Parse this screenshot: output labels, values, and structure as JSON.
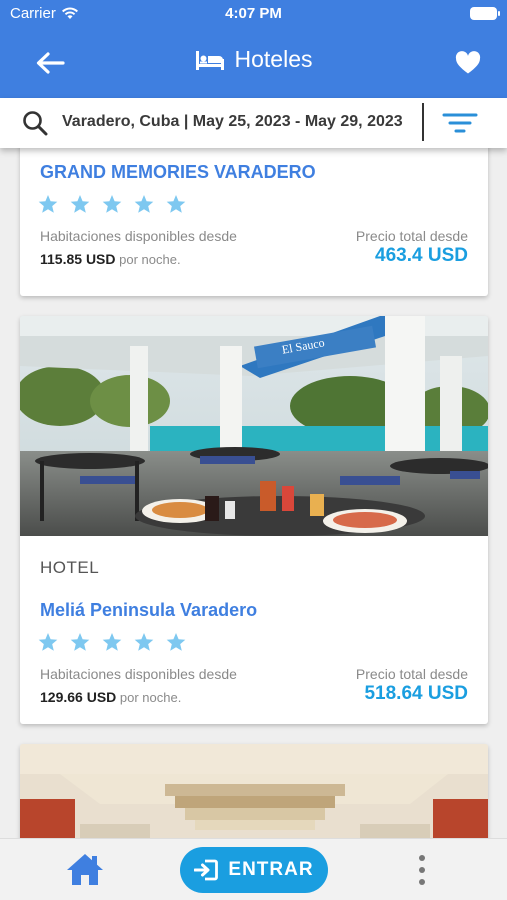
{
  "status_bar": {
    "carrier": "Carrier",
    "time": "4:07 PM"
  },
  "header": {
    "title": "Hoteles",
    "icons": [
      "back-arrow-icon",
      "bed-icon",
      "heart-icon"
    ]
  },
  "search": {
    "summary": "Varadero, Cuba | May 25, 2023 - May 29, 2023",
    "icons": [
      "search-icon",
      "filter-icon"
    ]
  },
  "hotels": [
    {
      "name": "GRAND MEMORIES VARADERO",
      "stars": 5,
      "availability_label": "Habitaciones disponibles desde",
      "price_night": "115.85 USD",
      "per_night": "por noche.",
      "total_label": "Precio total desde",
      "total_price": "463.4 USD"
    },
    {
      "type": "HOTEL",
      "name": "Meliá Peninsula Varadero",
      "stars": 5,
      "availability_label": "Habitaciones disponibles desde",
      "price_night": "129.66 USD",
      "per_night": "por noche.",
      "total_label": "Precio total desde",
      "total_price": "518.64 USD",
      "photo_sign": "El Sauco"
    }
  ],
  "bottom_bar": {
    "login_label": "ENTRAR",
    "icons": [
      "home-icon",
      "login-icon",
      "more-vertical-icon"
    ]
  },
  "colors": {
    "primary": "#3f7fe0",
    "accent": "#1a9ee0",
    "star": "#7ec8f0"
  }
}
